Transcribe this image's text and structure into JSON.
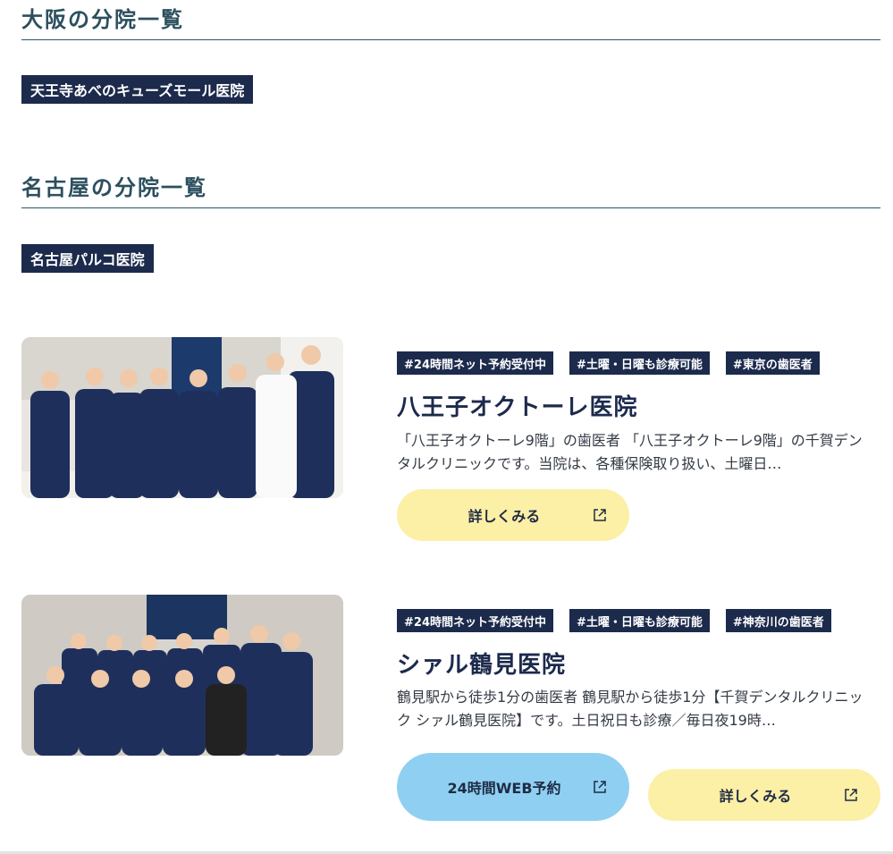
{
  "osaka": {
    "heading": "大阪の分院一覧",
    "branches": [
      "天王寺あべのキューズモール医院"
    ]
  },
  "nagoya": {
    "heading": "名古屋の分院一覧",
    "branches": [
      "名古屋パルコ医院"
    ]
  },
  "clinics": [
    {
      "tags": [
        "#24時間ネット予約受付中",
        "#土曜・日曜も診療可能",
        "#東京の歯医者"
      ],
      "name": "八王子オクトーレ医院",
      "description": "「八王子オクトーレ9階」の歯医者 「八王子オクトーレ9階」の千賀デンタルクリニックです。当院は、各種保険取り扱い、土曜日…",
      "details_label": "詳しくみる",
      "photo_icon": "staff-group-photo"
    },
    {
      "tags": [
        "#24時間ネット予約受付中",
        "#土曜・日曜も診療可能",
        "#神奈川の歯医者"
      ],
      "name": "シァル鶴見医院",
      "description": "鶴見駅から徒歩1分の歯医者 鶴見駅から徒歩1分【千賀デンタルクリニック シァル鶴見医院】です。土日祝日も診療／毎日夜19時…",
      "reserve_label": "24時間WEB予約",
      "details_label": "詳しくみる",
      "photo_icon": "staff-group-photo"
    }
  ],
  "colors": {
    "navy": "#1c2a4c",
    "heading": "#2c4f5e",
    "yellow_button": "#fcefa6",
    "blue_button": "#8fd0f2"
  }
}
